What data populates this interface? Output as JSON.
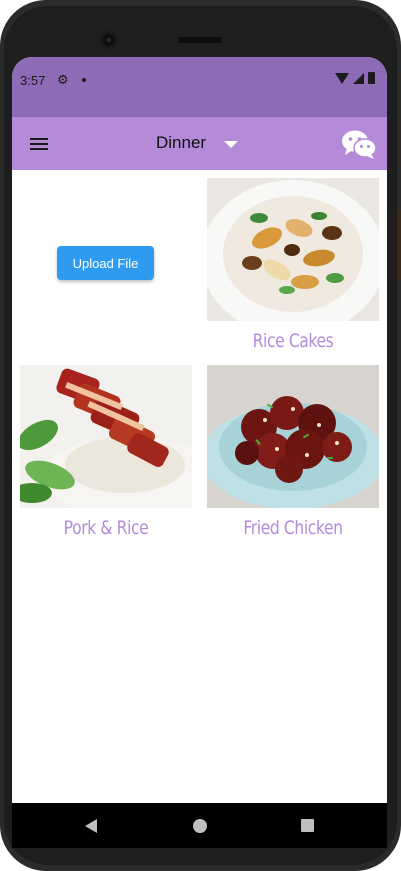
{
  "status_bar": {
    "time": "3:57",
    "icons": [
      "gear-icon",
      "dot-icon",
      "wifi-icon",
      "signal-icon",
      "battery-icon"
    ]
  },
  "app_bar": {
    "menu_icon": "hamburger-menu-icon",
    "dropdown": {
      "selected": "Dinner"
    },
    "action_icon": "wechat-icon",
    "color": "#b48ad9"
  },
  "main": {
    "upload_button": {
      "label": "Upload File",
      "color": "#2f9bf0"
    },
    "cards": [
      {
        "caption": "Rice Cakes"
      },
      {
        "caption": "Pork & Rice"
      },
      {
        "caption": "Fried Chicken"
      }
    ],
    "caption_color": "#b48ad9"
  },
  "nav_bar": {
    "icons": [
      "back-icon",
      "home-icon",
      "recents-icon"
    ]
  }
}
